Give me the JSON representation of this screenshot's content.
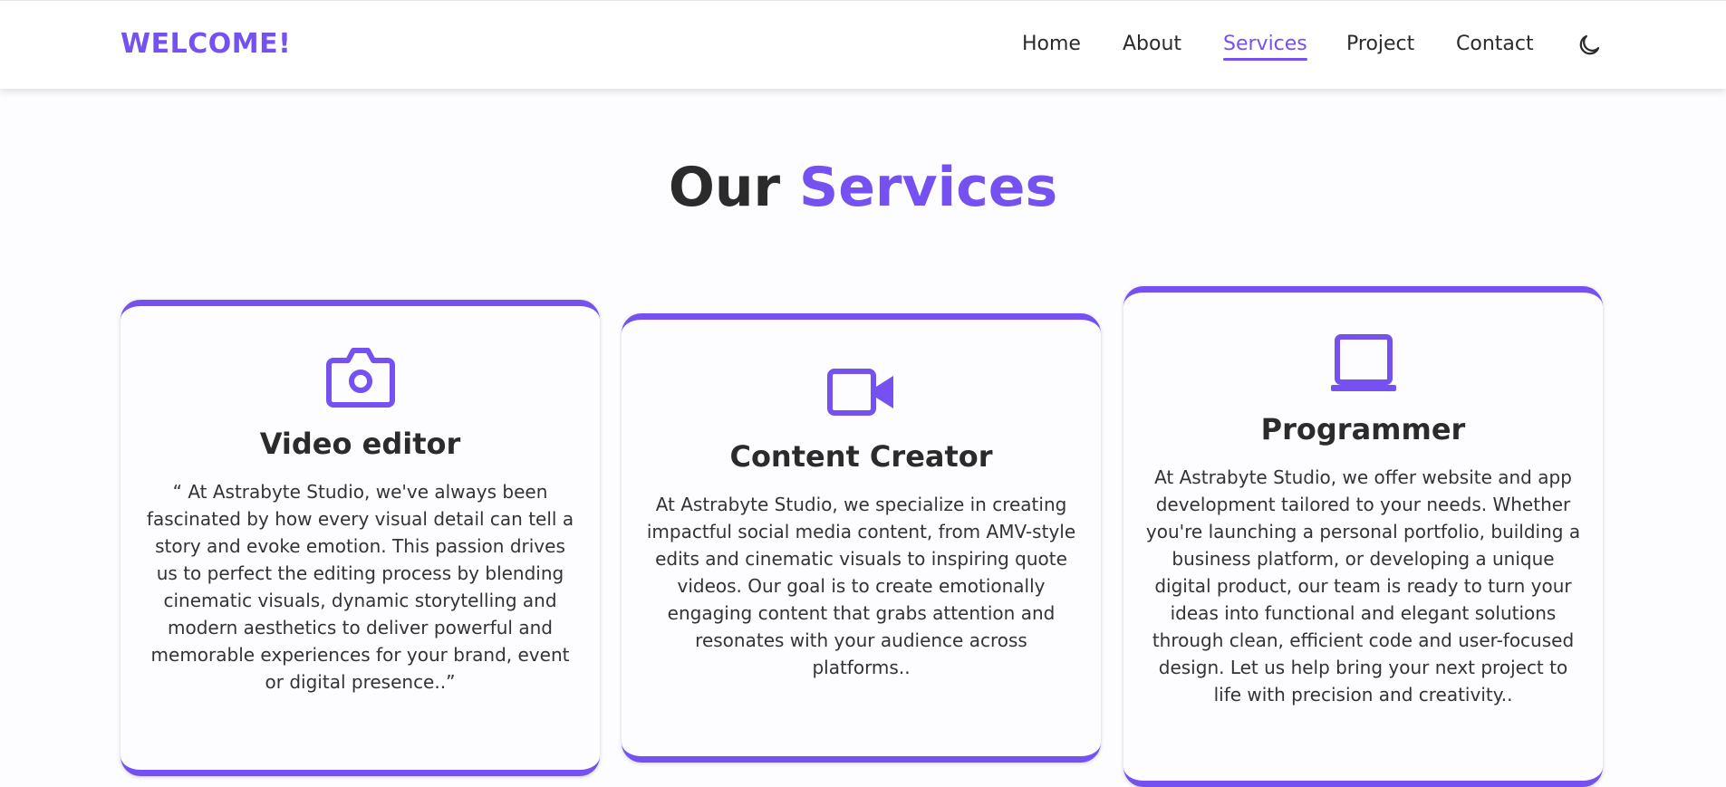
{
  "navbar": {
    "logo": "WELCOME!",
    "links": [
      "Home",
      "About",
      "Services",
      "Project",
      "Contact"
    ],
    "active_link": "Services",
    "theme_toggle_icon": "moon-icon"
  },
  "heading": {
    "prefix": "Our",
    "accent": "Services"
  },
  "cards": [
    {
      "icon": "camera-icon",
      "title": "Video editor",
      "description": "“ At Astrabyte Studio, we've always been fascinated by how every visual detail can tell a story and evoke emotion. This passion drives us to perfect the editing process by blending cinematic visuals, dynamic storytelling and modern aesthetics to deliver powerful and memorable experiences for your brand, event or digital presence..”"
    },
    {
      "icon": "video-camera-icon",
      "title": "Content Creator",
      "description": "At Astrabyte Studio, we specialize in creating impactful social media content, from AMV-style edits and cinematic visuals to inspiring quote videos. Our goal is to create emotionally engaging content that grabs attention and resonates with your audience across platforms.."
    },
    {
      "icon": "laptop-icon",
      "title": "Programmer",
      "description": "At Astrabyte Studio, we offer website and app development tailored to your needs. Whether you're launching a personal portfolio, building a business platform, or developing a unique digital product, our team is ready to turn your ideas into functional and elegant solutions through clean, efficient code and user-focused design. Let us help bring your next project to life with precision and creativity.."
    }
  ],
  "colors": {
    "accent": "#7451f0",
    "text": "#2b2b2b",
    "background": "#fdfcfe"
  }
}
